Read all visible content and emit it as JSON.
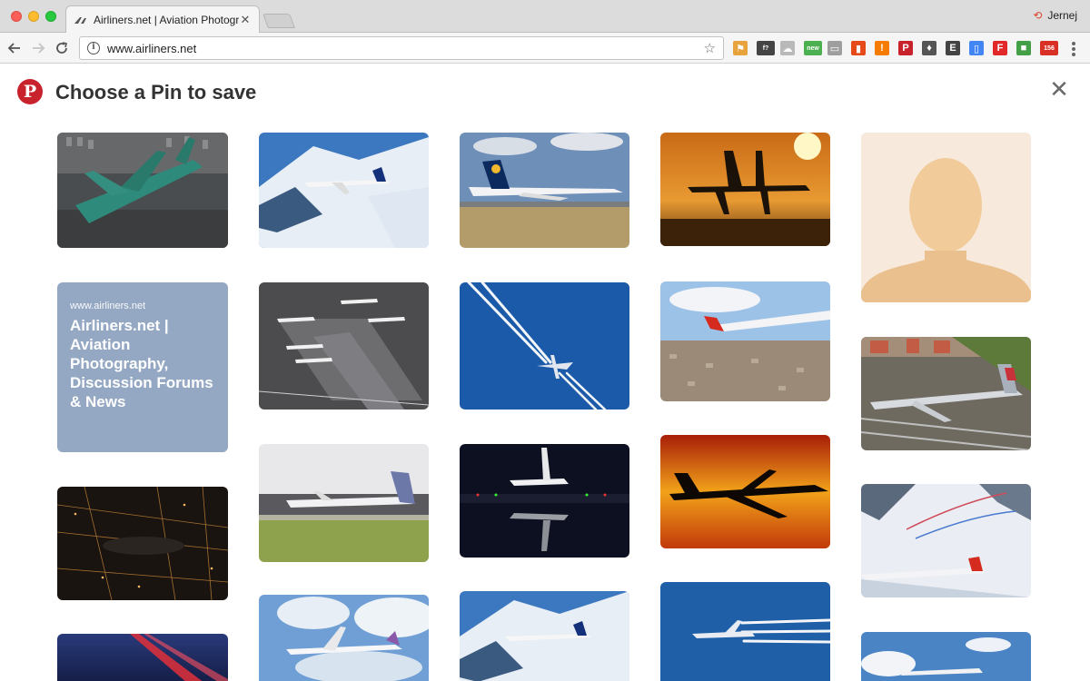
{
  "browser": {
    "tab_title": "Airliners.net | Aviation Photography, Discussion Forums & News",
    "tab_close": "✕",
    "profile_name": "Jernej",
    "url": "www.airliners.net",
    "extensions": [
      {
        "name": "bookmark-pin-icon",
        "color": "#e8a33c",
        "glyph": "⚑"
      },
      {
        "name": "fontface-icon",
        "color": "#444444",
        "glyph": "f?"
      },
      {
        "name": "cloud-icon",
        "color": "#b9b9b9",
        "glyph": "☁"
      },
      {
        "name": "new-badge-icon",
        "color": "#4caf50",
        "glyph": "new"
      },
      {
        "name": "folder-icon",
        "color": "#9e9e9e",
        "glyph": "▭"
      },
      {
        "name": "book-icon",
        "color": "#e64a19",
        "glyph": "▮"
      },
      {
        "name": "alert-icon",
        "color": "#f57c00",
        "glyph": "!"
      },
      {
        "name": "pinterest-icon",
        "color": "#c8232c",
        "glyph": "P"
      },
      {
        "name": "lightbulb-icon",
        "color": "#555555",
        "glyph": "♦"
      },
      {
        "name": "evernote-icon",
        "color": "#444444",
        "glyph": "E"
      },
      {
        "name": "docs-icon",
        "color": "#4285f4",
        "glyph": "▯"
      },
      {
        "name": "flipboard-icon",
        "color": "#e12828",
        "glyph": "F"
      },
      {
        "name": "swatch-icon",
        "color": "#43a047",
        "glyph": "■"
      },
      {
        "name": "mail-badge-icon",
        "color": "#d93025",
        "glyph": "156"
      }
    ]
  },
  "pinterest": {
    "logo_glyph": "P",
    "title": "Choose a Pin to save",
    "close_glyph": "✕",
    "text_pin": {
      "url": "www.airliners.net",
      "title": "Airliners.net | Aviation Photography, Discussion Forums & News"
    }
  }
}
